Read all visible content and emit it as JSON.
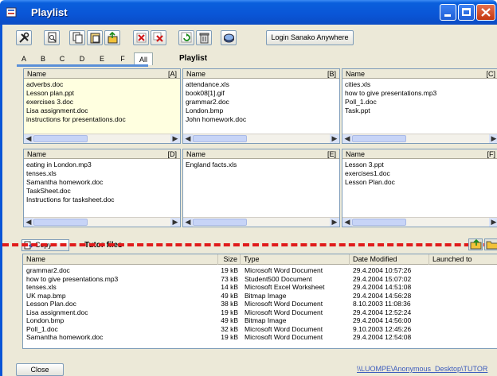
{
  "window": {
    "title": "Playlist"
  },
  "toolbar": {
    "buttons": [
      "tools-icon",
      "preview-icon",
      "copy-icon",
      "paste-icon",
      "export-icon",
      "delete-icon",
      "delete-all-icon",
      "refresh-icon",
      "trash-icon",
      "disk-icon"
    ],
    "login_label": "Login Sanako Anywhere"
  },
  "tabs": [
    "A",
    "B",
    "C",
    "D",
    "E",
    "F",
    "All"
  ],
  "playlist_label": "Playlist",
  "panes": [
    {
      "header": "Name",
      "tag": "[A]",
      "items": [
        "adverbs.doc",
        "Lesson plan.ppt",
        "exercises 3.doc",
        "Lisa assignment.doc",
        "instructions for presentations.doc"
      ]
    },
    {
      "header": "Name",
      "tag": "[B]",
      "items": [
        "attendance.xls",
        "book08[1].gif",
        "grammar2.doc",
        "London.bmp",
        "John homework.doc"
      ]
    },
    {
      "header": "Name",
      "tag": "[C]",
      "items": [
        "cities.xls",
        "how to give presentations.mp3",
        "Poll_1.doc",
        "Task.ppt"
      ]
    },
    {
      "header": "Name",
      "tag": "[D]",
      "items": [
        "eating in London.mp3",
        "tenses.xls",
        "Samantha homework.doc",
        "TaskSheet.doc",
        "Instructions for tasksheet.doc"
      ]
    },
    {
      "header": "Name",
      "tag": "[E]",
      "items": [
        "England facts.xls"
      ]
    },
    {
      "header": "Name",
      "tag": "[F]",
      "items": [
        "Lesson 3.ppt",
        "exercises1.doc",
        "Lesson Plan.doc"
      ]
    }
  ],
  "tutor": {
    "copy_label": "Copy",
    "label": "Tutor files",
    "columns": [
      "Name",
      "Size",
      "Type",
      "Date Modified",
      "Launched to"
    ],
    "rows": [
      [
        "grammar2.doc",
        "19 kB",
        "Microsoft Word Document",
        "29.4.2004 10:57:26",
        ""
      ],
      [
        "how to give presentations.mp3",
        "73 kB",
        "Student500 Document",
        "29.4.2004 15:07:02",
        ""
      ],
      [
        "tenses.xls",
        "14 kB",
        "Microsoft Excel Worksheet",
        "29.4.2004 14:51:08",
        ""
      ],
      [
        "UK map.bmp",
        "49 kB",
        "Bitmap Image",
        "29.4.2004 14:56:28",
        ""
      ],
      [
        "Lesson Plan.doc",
        "38 kB",
        "Microsoft Word Document",
        "8.10.2003 11:08:36",
        ""
      ],
      [
        "Lisa assignment.doc",
        "19 kB",
        "Microsoft Word Document",
        "29.4.2004 12:52:24",
        ""
      ],
      [
        "London.bmp",
        "49 kB",
        "Bitmap Image",
        "29.4.2004 14:56:00",
        ""
      ],
      [
        "Poll_1.doc",
        "32 kB",
        "Microsoft Word Document",
        "9.10.2003 12:45:26",
        ""
      ],
      [
        "Samantha homework.doc",
        "19 kB",
        "Microsoft Word Document",
        "29.4.2004 12:54:08",
        ""
      ]
    ]
  },
  "footer": {
    "close_label": "Close",
    "path": "\\\\LUOMPE\\Anonymous_Desktop\\TUTOR"
  },
  "colors": {
    "titlebar": "#0a55d6",
    "highlight_pane": "#ffffe0",
    "dash": "#e01b1b"
  }
}
